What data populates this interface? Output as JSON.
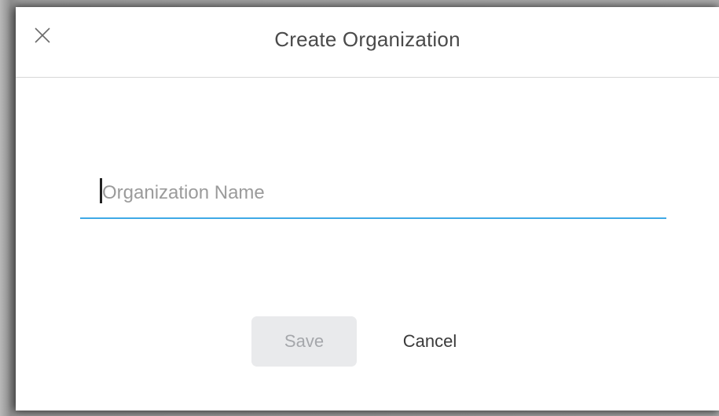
{
  "dialog": {
    "title": "Create Organization",
    "close_icon": "close-icon"
  },
  "form": {
    "org_name_value": "",
    "org_name_placeholder": "Organization Name"
  },
  "actions": {
    "save_label": "Save",
    "cancel_label": "Cancel"
  },
  "colors": {
    "accent_underline": "#3fa9e6",
    "save_disabled_bg": "#e9eaec",
    "save_disabled_text": "#a5a7ab"
  }
}
